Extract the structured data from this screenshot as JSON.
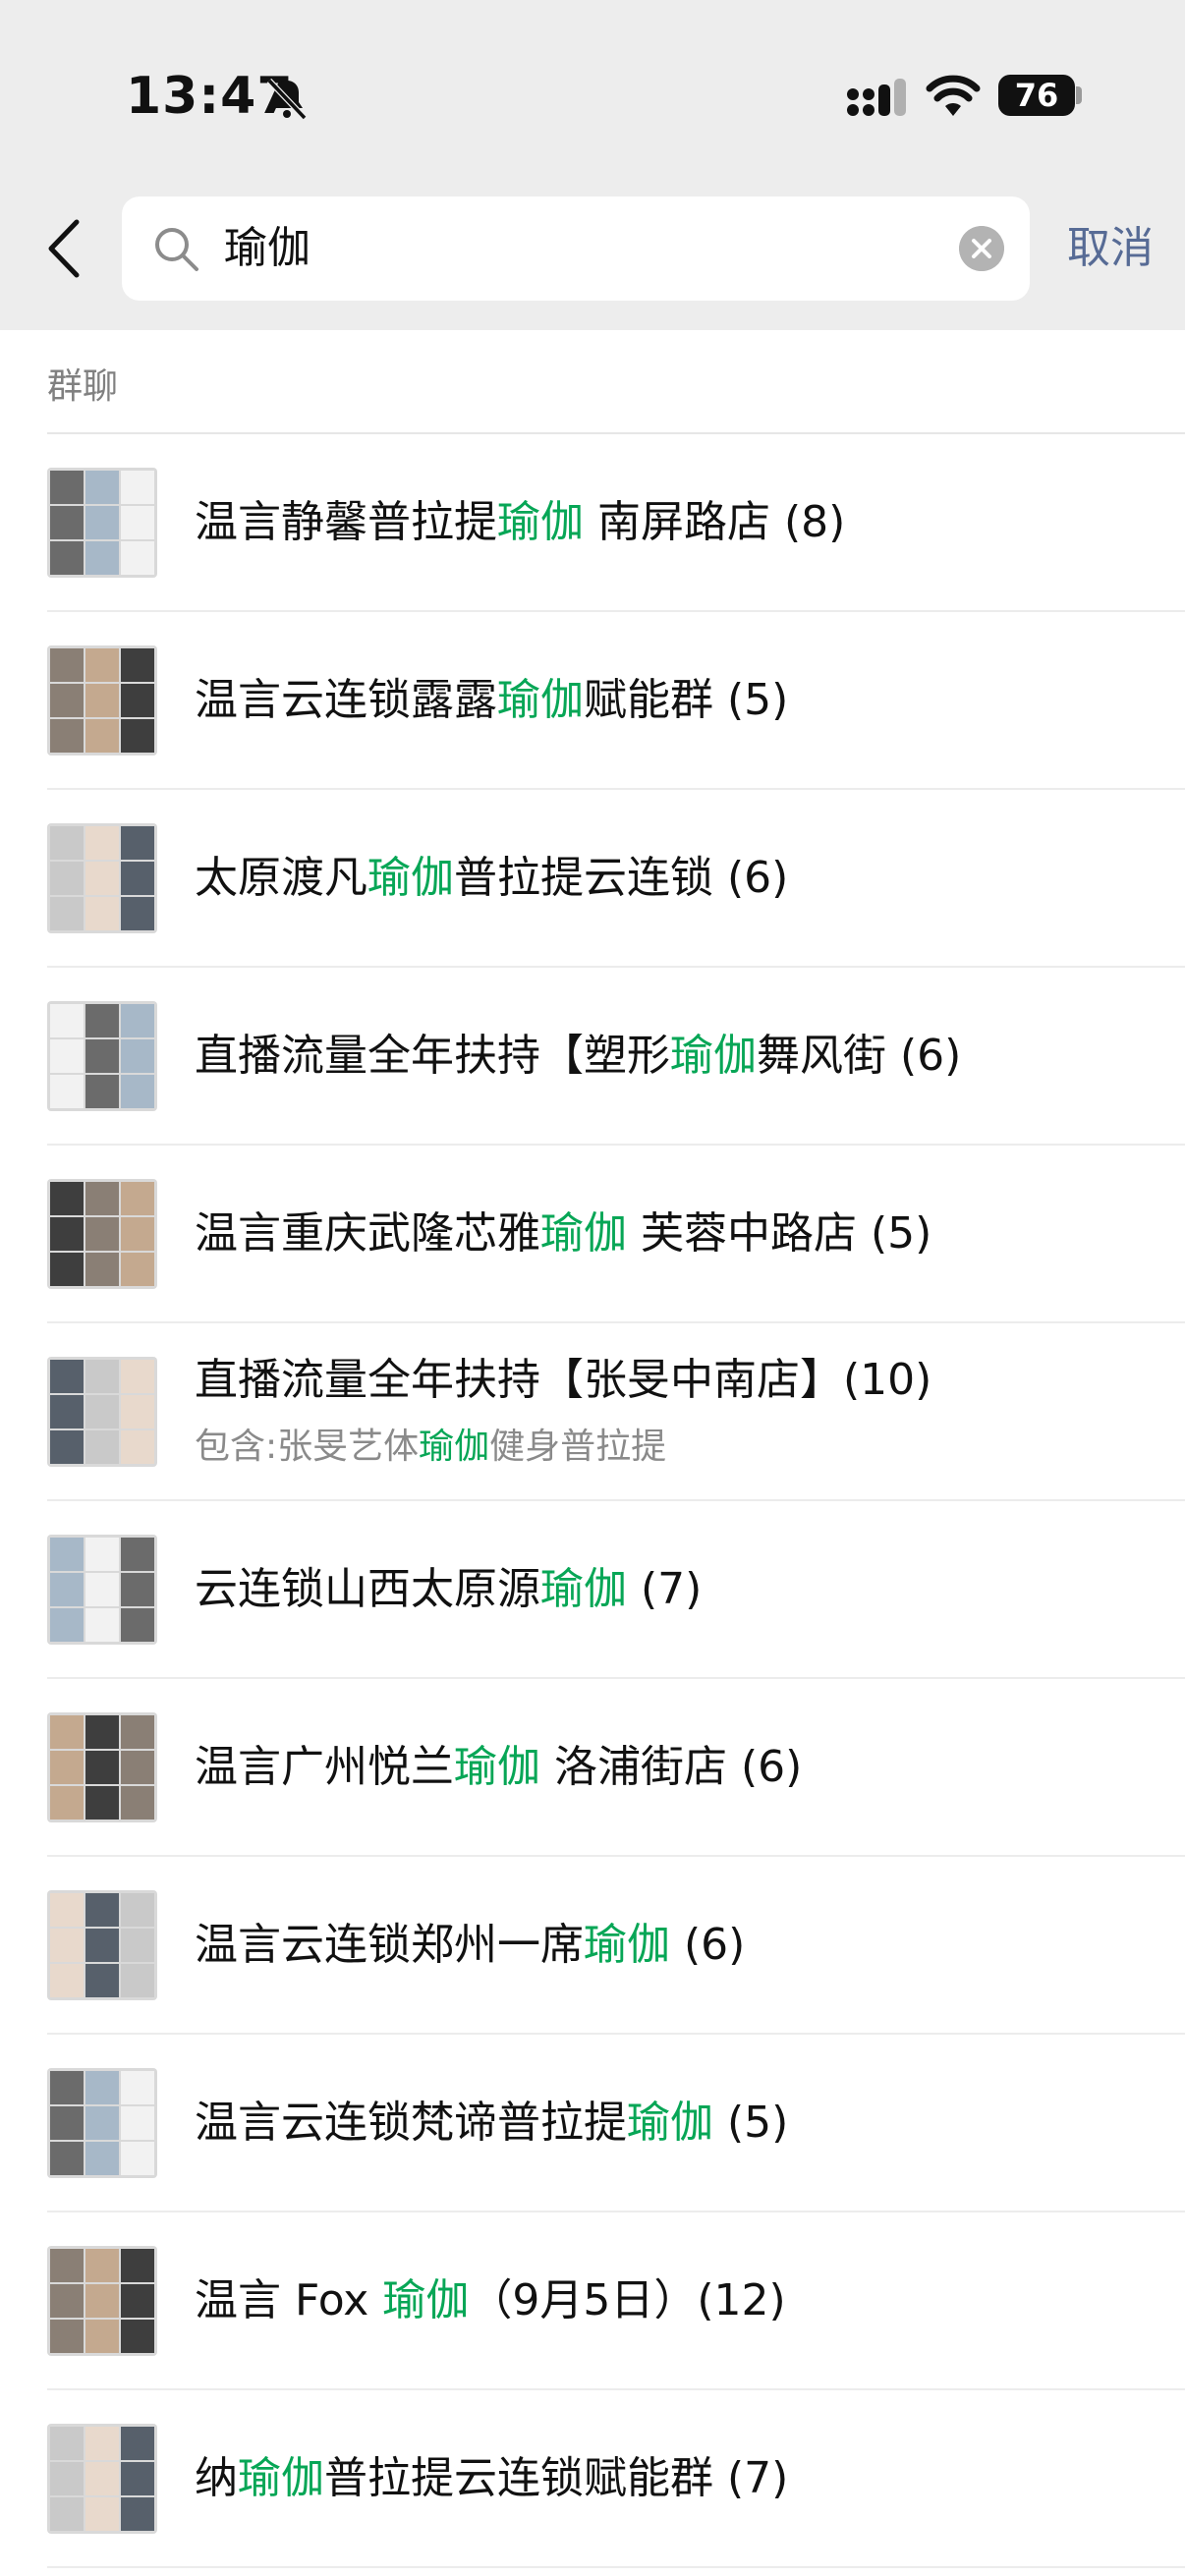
{
  "status_bar": {
    "time": "13:47",
    "battery": "76"
  },
  "search": {
    "query": "瑜伽",
    "cancel_label": "取消"
  },
  "section": {
    "title": "群聊"
  },
  "colors": {
    "highlight": "#07a656",
    "link": "#576b95",
    "top_bg": "#ededed"
  },
  "icons": [
    "back-arrow-icon",
    "search-icon",
    "clear-icon",
    "mute-bell-icon",
    "signal-icon",
    "wifi-icon",
    "battery-icon"
  ],
  "results": [
    {
      "pre": "温言静馨普拉提",
      "hl": "瑜伽",
      "post": " 南屏路店 (8)"
    },
    {
      "pre": "温言云连锁露露",
      "hl": "瑜伽",
      "post": "赋能群 (5)"
    },
    {
      "pre": "太原渡凡",
      "hl": "瑜伽",
      "post": "普拉提云连锁 (6)"
    },
    {
      "pre": "直播流量全年扶持【塑形",
      "hl": "瑜伽",
      "post": "舞风街 (6)"
    },
    {
      "pre": "温言重庆武隆芯雅",
      "hl": "瑜伽",
      "post": " 芙蓉中路店 (5)"
    },
    {
      "pre": "直播流量全年扶持【张旻中南店】(10)",
      "hl": "",
      "post": "",
      "sub_pre": "包含:张旻艺体",
      "sub_hl": "瑜伽",
      "sub_post": "健身普拉提"
    },
    {
      "pre": "云连锁山西太原源",
      "hl": "瑜伽",
      "post": " (7)"
    },
    {
      "pre": "温言广州悦兰",
      "hl": "瑜伽",
      "post": " 洛浦街店 (6)"
    },
    {
      "pre": "温言云连锁郑州一席",
      "hl": "瑜伽",
      "post": " (6)"
    },
    {
      "pre": "温言云连锁梵谛普拉提",
      "hl": "瑜伽",
      "post": " (5)"
    },
    {
      "pre": "温言 Fox ",
      "hl": "瑜伽",
      "post": "（9月5日）(12)"
    },
    {
      "pre": "纳",
      "hl": "瑜伽",
      "post": "普拉提云连锁赋能群 (7)"
    }
  ]
}
